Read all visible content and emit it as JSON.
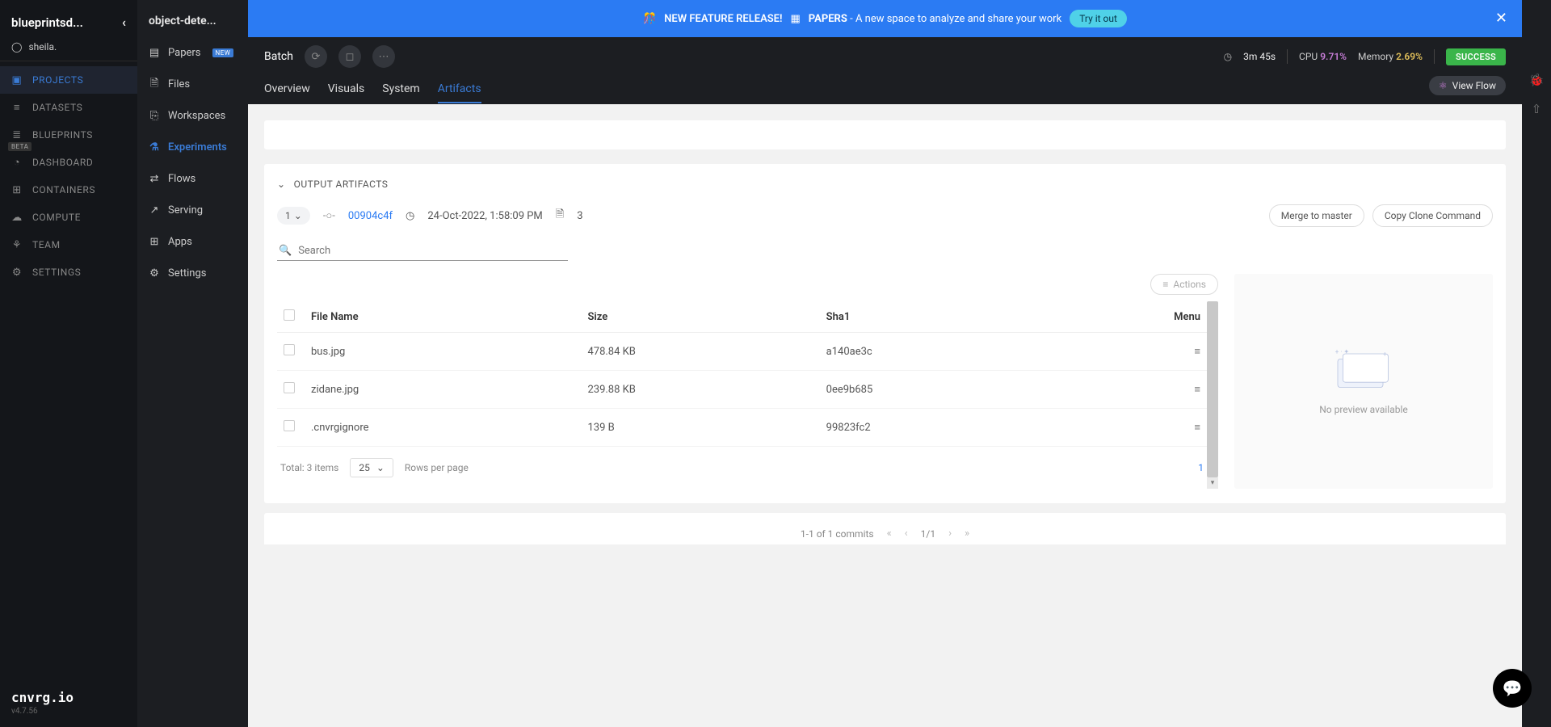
{
  "sidebar1": {
    "org": "blueprintsd...",
    "user": "sheila.",
    "items": [
      {
        "icon": "▣",
        "label": "PROJECTS",
        "active": true
      },
      {
        "icon": "≡",
        "label": "DATASETS"
      },
      {
        "icon": "≣",
        "label": "BLUEPRINTS",
        "beta": "BETA"
      },
      {
        "icon": "◔",
        "label": "DASHBOARD"
      },
      {
        "icon": "⊞",
        "label": "CONTAINERS"
      },
      {
        "icon": "☁",
        "label": "COMPUTE"
      },
      {
        "icon": "⚘",
        "label": "TEAM"
      },
      {
        "icon": "⚙",
        "label": "SETTINGS"
      }
    ],
    "brand": "cnvrg.io",
    "version": "v4.7.56"
  },
  "sidebar2": {
    "title": "object-dete...",
    "items": [
      {
        "icon": "▤",
        "label": "Papers",
        "badge": "NEW"
      },
      {
        "icon": "🗎",
        "label": "Files"
      },
      {
        "icon": "⎘",
        "label": "Workspaces"
      },
      {
        "icon": "⚗",
        "label": "Experiments",
        "active": true
      },
      {
        "icon": "⇄",
        "label": "Flows"
      },
      {
        "icon": "↗",
        "label": "Serving"
      },
      {
        "icon": "⊞",
        "label": "Apps"
      },
      {
        "icon": "⚙",
        "label": "Settings"
      }
    ]
  },
  "banner": {
    "headline": "NEW FEATURE RELEASE!",
    "name": "PAPERS",
    "desc": "- A new space to analyze and share your work",
    "cta": "Try it out"
  },
  "topbar": {
    "title": "Batch",
    "duration": "3m 45s",
    "cpu_label": "CPU",
    "cpu_value": "9.71%",
    "mem_label": "Memory",
    "mem_value": "2.69%",
    "status": "SUCCESS"
  },
  "tabs": {
    "items": [
      "Overview",
      "Visuals",
      "System",
      "Artifacts"
    ],
    "active": "Artifacts",
    "view_flow": "View Flow"
  },
  "section": {
    "title": "OUTPUT ARTIFACTS"
  },
  "commit": {
    "count": "1",
    "hash": "00904c4f",
    "date": "24-Oct-2022, 1:58:09 PM",
    "files": "3",
    "merge": "Merge to master",
    "clone": "Copy Clone Command"
  },
  "search": {
    "placeholder": "Search"
  },
  "actions_btn": "Actions",
  "table": {
    "headers": {
      "name": "File Name",
      "size": "Size",
      "sha": "Sha1",
      "menu": "Menu"
    },
    "rows": [
      {
        "name": "bus.jpg",
        "size": "478.84 KB",
        "sha": "a140ae3c"
      },
      {
        "name": "zidane.jpg",
        "size": "239.88 KB",
        "sha": "0ee9b685"
      },
      {
        "name": ".cnvrgignore",
        "size": "139 B",
        "sha": "99823fc2"
      }
    ],
    "total": "Total: 3 items",
    "page_size": "25",
    "rows_label": "Rows per page",
    "page_num": "1"
  },
  "preview": {
    "empty": "No preview available"
  },
  "commits_pager": {
    "label": "1-1 of 1 commits",
    "page": "1/1"
  }
}
